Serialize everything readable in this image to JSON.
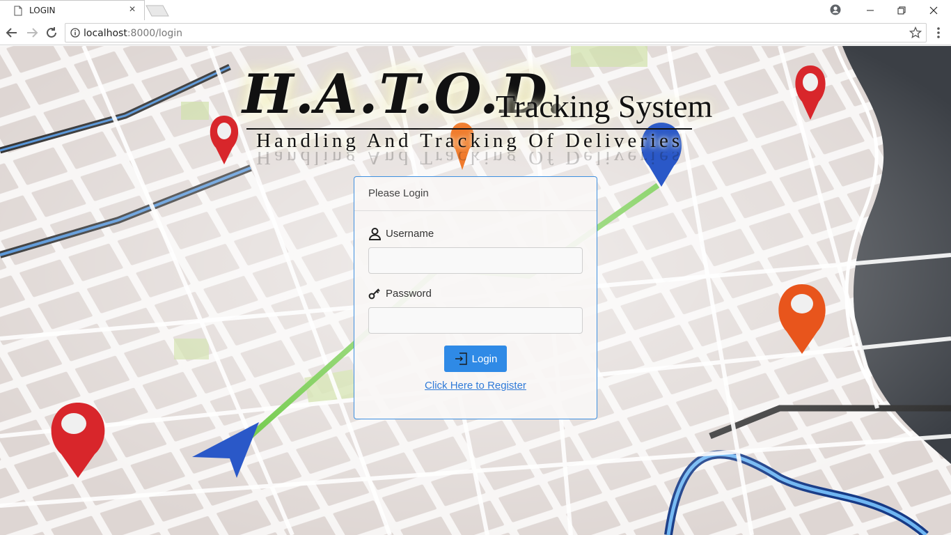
{
  "browser": {
    "tab_title": "LOGIN",
    "url_host": "localhost",
    "url_path": ":8000/login"
  },
  "logo": {
    "main_text": "H.A.T.O.D.",
    "side_text": "Tracking System",
    "tagline": "Handling And Tracking Of Deliveries"
  },
  "login": {
    "header": "Please Login",
    "username_label": "Username",
    "username_value": "",
    "password_label": "Password",
    "password_value": "",
    "submit_label": "Login",
    "register_link": "Click Here to Register"
  },
  "colors": {
    "accent": "#2f8ae6",
    "route": "#5cc22e",
    "pin_red": "#d8262b",
    "pin_orange": "#e8551c",
    "pin_blue": "#2a58c8"
  }
}
